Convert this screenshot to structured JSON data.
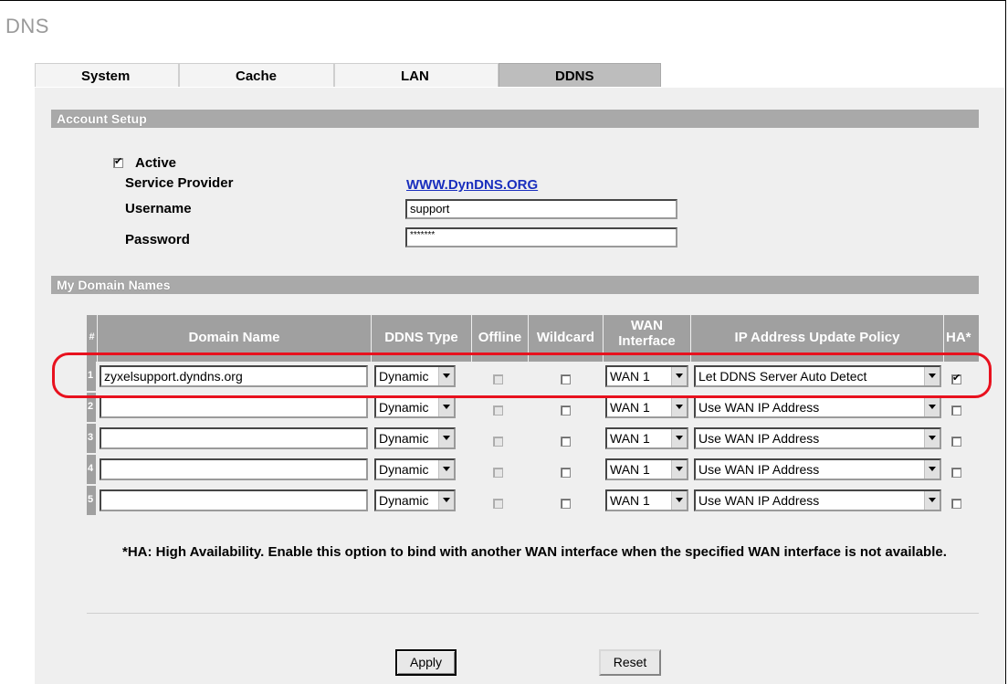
{
  "page": {
    "title": "DNS"
  },
  "tabs": [
    {
      "label": "System"
    },
    {
      "label": "Cache"
    },
    {
      "label": "LAN"
    },
    {
      "label": "DDNS",
      "active": true
    }
  ],
  "account_setup": {
    "heading": "Account Setup",
    "active_label": "Active",
    "active_checked": true,
    "service_provider_label": "Service Provider",
    "service_provider_value": "WWW.DynDNS.ORG",
    "username_label": "Username",
    "username_value": "support",
    "password_label": "Password",
    "password_value": "*******"
  },
  "domains": {
    "heading": "My Domain Names",
    "columns": {
      "index": "#",
      "domain_name": "Domain Name",
      "ddns_type": "DDNS Type",
      "offline": "Offline",
      "wildcard": "Wildcard",
      "wan_interface": "WAN Interface",
      "ip_policy": "IP Address Update Policy",
      "ha": "HA*"
    },
    "rows": [
      {
        "index": "1",
        "domain": "zyxelsupport.dyndns.org",
        "ddns_type": "Dynamic",
        "offline": false,
        "wildcard": false,
        "wan": "WAN 1",
        "policy": "Let DDNS Server Auto Detect",
        "ha": true
      },
      {
        "index": "2",
        "domain": "",
        "ddns_type": "Dynamic",
        "offline": false,
        "wildcard": false,
        "wan": "WAN 1",
        "policy": "Use WAN IP Address",
        "ha": false
      },
      {
        "index": "3",
        "domain": "",
        "ddns_type": "Dynamic",
        "offline": false,
        "wildcard": false,
        "wan": "WAN 1",
        "policy": "Use WAN IP Address",
        "ha": false
      },
      {
        "index": "4",
        "domain": "",
        "ddns_type": "Dynamic",
        "offline": false,
        "wildcard": false,
        "wan": "WAN 1",
        "policy": "Use WAN IP Address",
        "ha": false
      },
      {
        "index": "5",
        "domain": "",
        "ddns_type": "Dynamic",
        "offline": false,
        "wildcard": false,
        "wan": "WAN 1",
        "policy": "Use WAN IP Address",
        "ha": false
      }
    ]
  },
  "note": "*HA: High Availability. Enable this option to bind with another WAN interface when the specified WAN interface is not available.",
  "buttons": {
    "apply": "Apply",
    "reset": "Reset"
  },
  "colors": {
    "highlight": "#e8111e",
    "link": "#1a2fbe",
    "header_gray": "#a0a0a0",
    "panel": "#efefef"
  }
}
